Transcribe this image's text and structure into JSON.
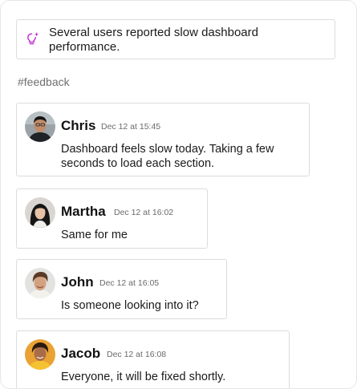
{
  "summary": {
    "icon": "lightbulb-sparkle-icon",
    "accent": "#c026d3",
    "text": "Several users reported slow dashboard performance."
  },
  "channel": "#feedback",
  "messages": [
    {
      "author": "Chris",
      "time": "Dec 12 at 15:45",
      "text": "Dashboard feels slow today. Taking a few seconds to load each section."
    },
    {
      "author": "Martha",
      "time": "Dec 12 at 16:02",
      "text": "Same for me"
    },
    {
      "author": "John",
      "time": "Dec 12 at 16:05",
      "text": "Is someone looking into it?"
    },
    {
      "author": "Jacob",
      "time": "Dec 12 at 16:08",
      "text": "Everyone, it will be fixed shortly."
    }
  ]
}
